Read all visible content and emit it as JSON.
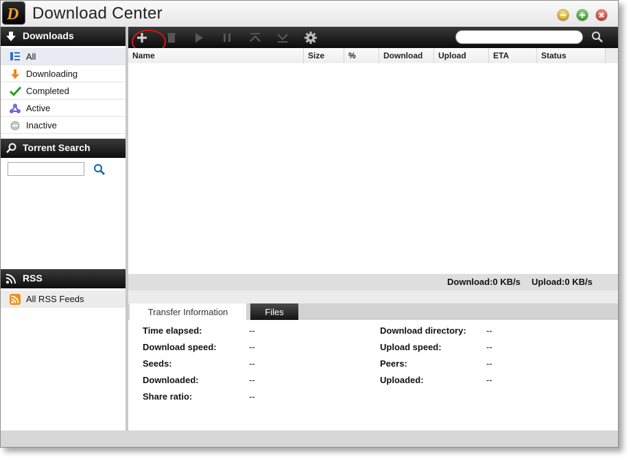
{
  "window": {
    "title": "Download Center",
    "logo_letter": "D"
  },
  "sidebar": {
    "downloads_header": "Downloads",
    "items": [
      {
        "label": "All",
        "icon": "list-icon",
        "selected": true
      },
      {
        "label": "Downloading",
        "icon": "download-arrow-icon"
      },
      {
        "label": "Completed",
        "icon": "checkmark-icon"
      },
      {
        "label": "Active",
        "icon": "active-nodes-icon"
      },
      {
        "label": "Inactive",
        "icon": "inactive-circle-icon"
      }
    ],
    "torrent_search_header": "Torrent Search",
    "torrent_search_placeholder": "",
    "rss_header": "RSS",
    "rss_items": [
      {
        "label": "All RSS Feeds",
        "icon": "rss-feed-icon"
      }
    ]
  },
  "toolbar": {
    "buttons": [
      {
        "name": "add",
        "icon": "plus-icon",
        "enabled": true
      },
      {
        "name": "delete",
        "icon": "trash-icon",
        "enabled": false
      },
      {
        "name": "start",
        "icon": "play-icon",
        "enabled": false
      },
      {
        "name": "pause",
        "icon": "pause-icon",
        "enabled": false
      },
      {
        "name": "move-up",
        "icon": "move-top-icon",
        "enabled": false
      },
      {
        "name": "move-down",
        "icon": "move-bottom-icon",
        "enabled": false
      },
      {
        "name": "settings",
        "icon": "gear-icon",
        "enabled": true
      }
    ],
    "search_placeholder": ""
  },
  "table": {
    "columns": [
      "Name",
      "Size",
      "%",
      "Download",
      "Upload",
      "ETA",
      "Status"
    ],
    "rows": []
  },
  "speed": {
    "download": "Download:0 KB/s",
    "upload": "Upload:0 KB/s"
  },
  "details_tabs": {
    "transfer": "Transfer Information",
    "files": "Files",
    "active": "transfer"
  },
  "details": {
    "left": [
      {
        "label": "Time elapsed:",
        "value": "--"
      },
      {
        "label": "Download speed:",
        "value": "--"
      },
      {
        "label": "Seeds:",
        "value": "--"
      },
      {
        "label": "Downloaded:",
        "value": "--"
      },
      {
        "label": "Share ratio:",
        "value": "--"
      }
    ],
    "right": [
      {
        "label": "Download directory:",
        "value": "--"
      },
      {
        "label": "Upload speed:",
        "value": "--"
      },
      {
        "label": "Peers:",
        "value": "--"
      },
      {
        "label": "Uploaded:",
        "value": "--"
      }
    ]
  },
  "colors": {
    "header_dark": "#111111",
    "highlight_ring": "#d41414",
    "minimize": "#e2b21c",
    "maximize": "#3fa824",
    "close": "#d9322a"
  }
}
